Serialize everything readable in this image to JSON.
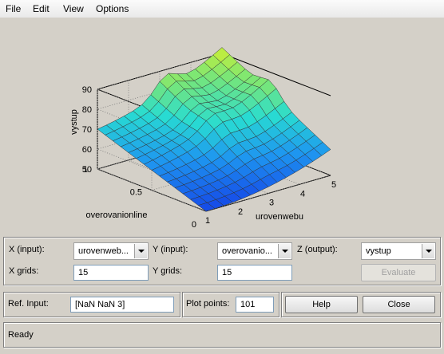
{
  "menu": {
    "file": "File",
    "edit": "Edit",
    "view": "View",
    "options": "Options"
  },
  "chart_data": {
    "type": "surface",
    "x": [
      1,
      1.2857,
      1.5714,
      1.8571,
      2.1429,
      2.4286,
      2.7143,
      3,
      3.2857,
      3.5714,
      3.8571,
      4.1429,
      4.4286,
      4.7143,
      5
    ],
    "y": [
      0,
      0.0714,
      0.1429,
      0.2143,
      0.2857,
      0.3571,
      0.4286,
      0.5,
      0.5714,
      0.6429,
      0.7143,
      0.7857,
      0.8571,
      0.9286,
      1
    ],
    "zlim": [
      50,
      90
    ],
    "xlabel": "urovenwebu",
    "ylabel": "overovanionline",
    "zlabel": "vystup",
    "xticks": [
      "1",
      "2",
      "3",
      "4",
      "5"
    ],
    "yticks": [
      "0",
      "0.5",
      "1"
    ],
    "zticks": [
      "50",
      "60",
      "70",
      "80",
      "90"
    ],
    "corner_values": {
      "x1_y0": 50,
      "x5_y0": 63,
      "x1_y1": 70,
      "x5_y1": 94,
      "x3_y1": 85,
      "x3_y0": 52
    },
    "colormap": "jet-like (blue low, yellow-green high)",
    "grid": true
  },
  "controls": {
    "x_input_label": "X (input):",
    "x_input_value": "urovenweb...",
    "y_input_label": "Y (input):",
    "y_input_value": "overovanio...",
    "z_output_label": "Z (output):",
    "z_output_value": "vystup",
    "x_grids_label": "X grids:",
    "x_grids_value": "15",
    "y_grids_label": "Y grids:",
    "y_grids_value": "15",
    "evaluate_label": "Evaluate"
  },
  "bottom": {
    "ref_input_label": "Ref. Input:",
    "ref_input_value": "[NaN NaN 3]",
    "plot_points_label": "Plot points:",
    "plot_points_value": "101",
    "help_label": "Help",
    "close_label": "Close"
  },
  "status": {
    "text": "Ready"
  }
}
